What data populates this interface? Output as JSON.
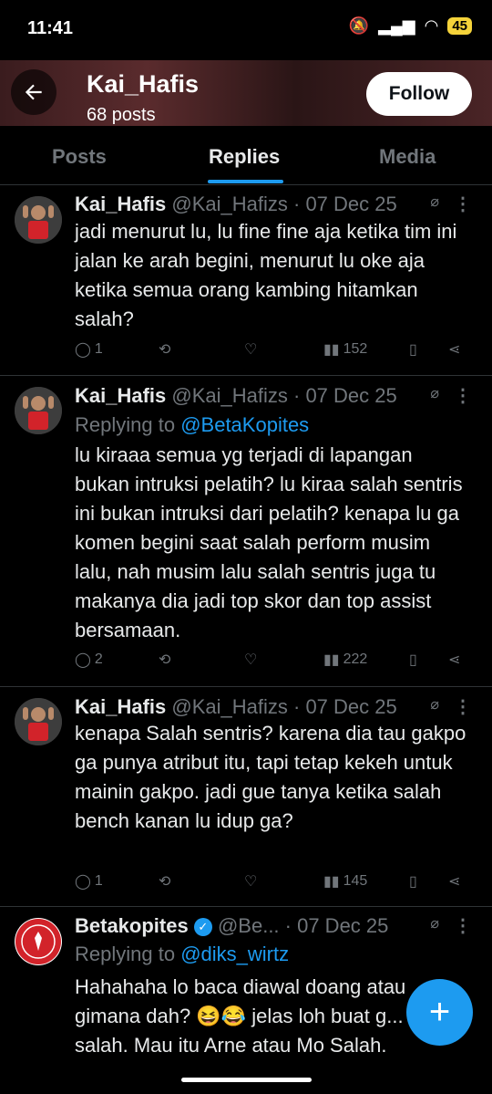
{
  "status": {
    "time": "11:41",
    "battery": "45"
  },
  "header": {
    "name": "Kai_Hafis",
    "posts": "68 posts",
    "follow_label": "Follow"
  },
  "tabs": [
    {
      "label": "Posts"
    },
    {
      "label": "Replies"
    },
    {
      "label": "Media"
    }
  ],
  "posts": [
    {
      "name": "Kai_Hafis",
      "meta": "@Kai_Hafizs · 07 Dec 25",
      "text": "jadi menurut lu, lu fine fine aja ketika tim ini jalan ke arah begini, menurut lu oke aja ketika semua orang kambing hitamkan salah?",
      "replies": "1",
      "views": "152"
    },
    {
      "name": "Kai_Hafis",
      "meta": "@Kai_Hafizs · 07 Dec 25",
      "reply_prefix": "Replying to",
      "reply_handle": "@BetaKopites",
      "text": "lu kiraaa semua yg terjadi di lapangan bukan intruksi pelatih? lu kiraa salah sentris ini bukan intruksi dari pelatih? kenapa lu ga komen begini saat salah perform musim lalu, nah musim lalu salah sentris juga tu makanya dia jadi top skor dan top assist bersamaan.",
      "replies": "2",
      "views": "222"
    },
    {
      "name": "Kai_Hafis",
      "meta": "@Kai_Hafizs · 07 Dec 25",
      "text": "kenapa Salah sentris? karena dia tau gakpo ga punya atribut itu, tapi tetap kekeh untuk mainin gakpo. jadi gue tanya ketika salah bench kanan lu idup ga?",
      "replies": "1",
      "views": "145"
    },
    {
      "name": "Betakopites",
      "meta": "@Be... · 07 Dec 25",
      "reply_prefix": "Replying to",
      "reply_handle": "@diks_wirtz",
      "text": "Hahahaha lo baca diawal doang atau gimana dah? 😆😂 jelas loh buat g... 2 nya salah. Mau itu Arne atau Mo Salah."
    }
  ],
  "colors": {
    "accent": "#1d9bf0",
    "muted": "#71767b",
    "text": "#e7e9ea",
    "background": "#000000"
  }
}
